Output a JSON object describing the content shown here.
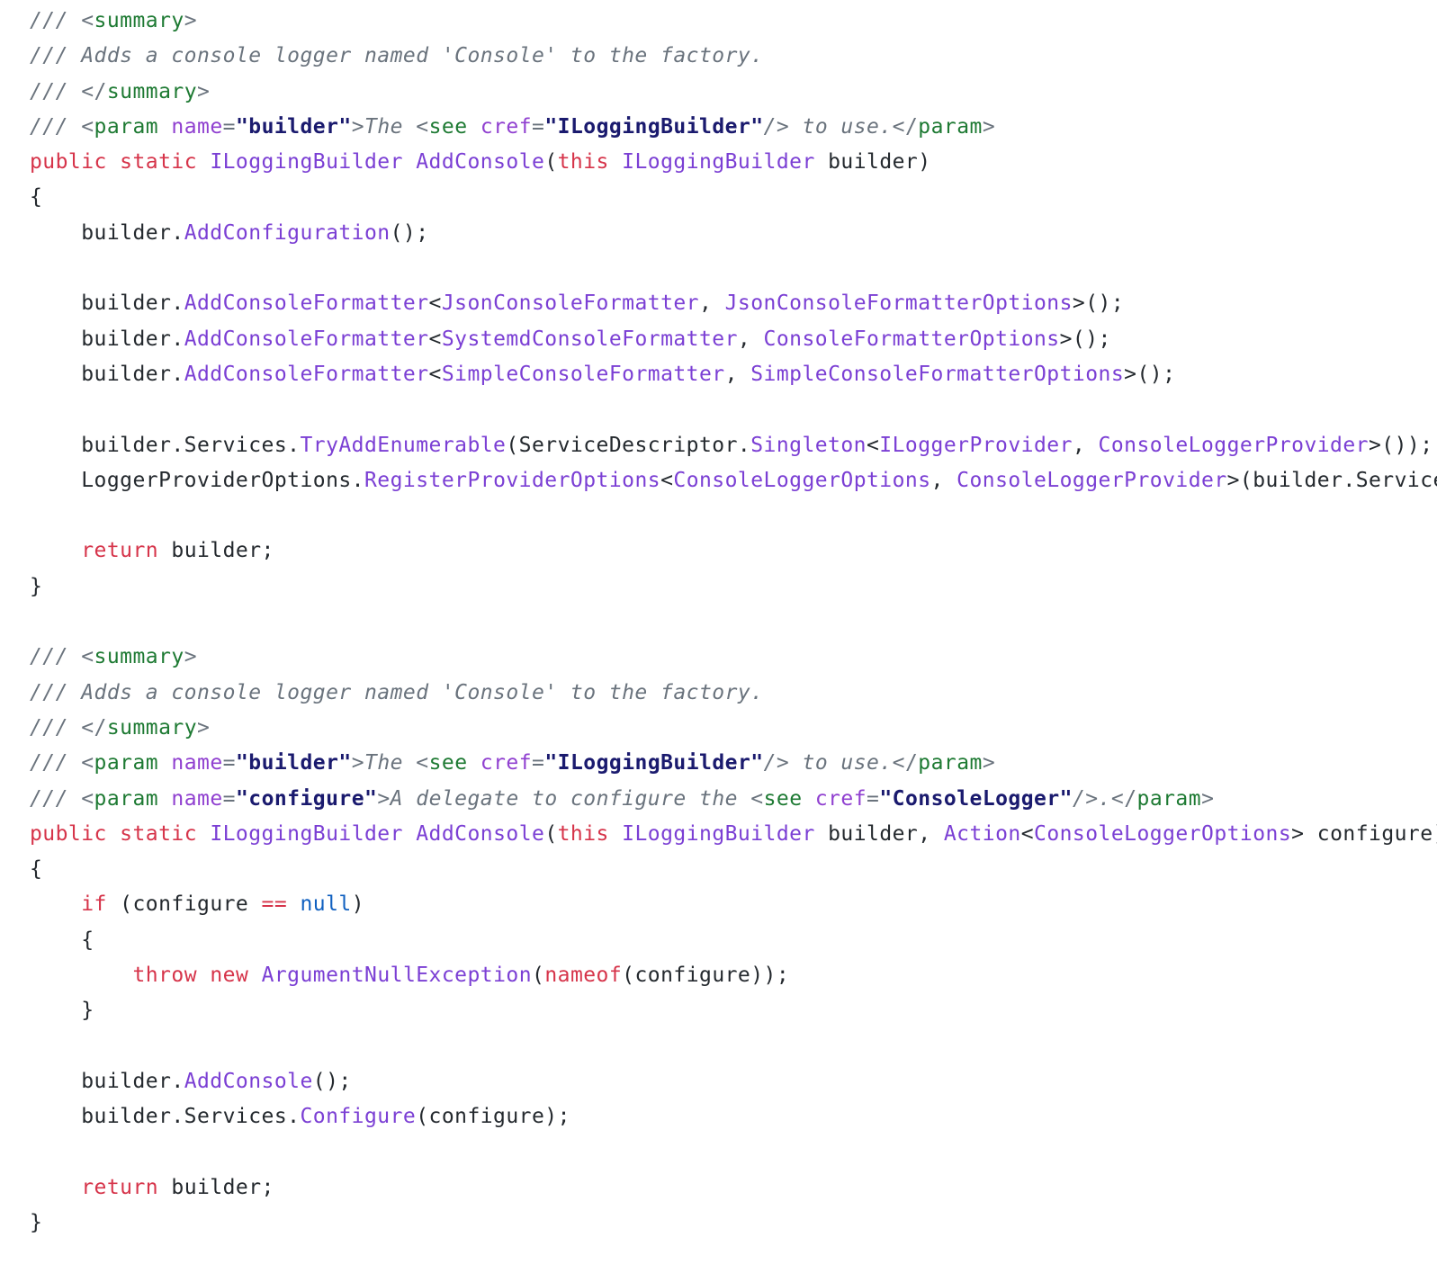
{
  "editor": {
    "language": "csharp",
    "background_color": "#ffffff",
    "font_size_px": 23,
    "line_height_px": 39.3,
    "indent_spaces": 4
  },
  "palette": {
    "plain": "#24292e",
    "comment": "#6a737d",
    "xml_tag": "#1e7a33",
    "xml_punctuation": "#6a737d",
    "xml_attribute_name": "#9040d0",
    "xml_attribute_value": "#1a1a6e",
    "keyword": "#d6344a",
    "null_literal": "#1060c0",
    "type": "#7b3fd4",
    "method": "#7b3fd4",
    "operator": "#d6344a"
  },
  "code": {
    "plain_text": "/// <summary>\n/// Adds a console logger named 'Console' to the factory.\n/// </summary>\n/// <param name=\"builder\">The <see cref=\"ILoggingBuilder\"/> to use.</param>\npublic static ILoggingBuilder AddConsole(this ILoggingBuilder builder)\n{\n    builder.AddConfiguration();\n\n    builder.AddConsoleFormatter<JsonConsoleFormatter, JsonConsoleFormatterOptions>();\n    builder.AddConsoleFormatter<SystemdConsoleFormatter, ConsoleFormatterOptions>();\n    builder.AddConsoleFormatter<SimpleConsoleFormatter, SimpleConsoleFormatterOptions>();\n\n    builder.Services.TryAddEnumerable(ServiceDescriptor.Singleton<ILoggerProvider, ConsoleLoggerProvider>());\n    LoggerProviderOptions.RegisterProviderOptions<ConsoleLoggerOptions, ConsoleLoggerProvider>(builder.Services);\n\n    return builder;\n}\n\n/// <summary>\n/// Adds a console logger named 'Console' to the factory.\n/// </summary>\n/// <param name=\"builder\">The <see cref=\"ILoggingBuilder\"/> to use.</param>\n/// <param name=\"configure\">A delegate to configure the <see cref=\"ConsoleLogger\"/>.</param>\npublic static ILoggingBuilder AddConsole(this ILoggingBuilder builder, Action<ConsoleLoggerOptions> configure)\n{\n    if (configure == null)\n    {\n        throw new ArgumentNullException(nameof(configure));\n    }\n\n    builder.AddConsole();\n    builder.Services.Configure(configure);\n\n    return builder;\n}",
    "lines": [
      {
        "tokens": [
          {
            "t": "/// ",
            "c": "comment"
          },
          {
            "t": "<",
            "c": "xml_punctuation"
          },
          {
            "t": "summary",
            "c": "xml_tag"
          },
          {
            "t": ">",
            "c": "xml_punctuation"
          }
        ]
      },
      {
        "tokens": [
          {
            "t": "/// Adds a console logger named 'Console' to the factory.",
            "c": "comment"
          }
        ]
      },
      {
        "tokens": [
          {
            "t": "/// ",
            "c": "comment"
          },
          {
            "t": "</",
            "c": "xml_punctuation"
          },
          {
            "t": "summary",
            "c": "xml_tag"
          },
          {
            "t": ">",
            "c": "xml_punctuation"
          }
        ]
      },
      {
        "tokens": [
          {
            "t": "/// ",
            "c": "comment"
          },
          {
            "t": "<",
            "c": "xml_punctuation"
          },
          {
            "t": "param",
            "c": "xml_tag"
          },
          {
            "t": " ",
            "c": "comment"
          },
          {
            "t": "name",
            "c": "xml_attribute_name"
          },
          {
            "t": "=",
            "c": "xml_punctuation"
          },
          {
            "t": "\"builder\"",
            "c": "xml_attribute_value"
          },
          {
            "t": ">The ",
            "c": "comment"
          },
          {
            "t": "<",
            "c": "xml_punctuation"
          },
          {
            "t": "see",
            "c": "xml_tag"
          },
          {
            "t": " ",
            "c": "comment"
          },
          {
            "t": "cref",
            "c": "xml_attribute_name"
          },
          {
            "t": "=",
            "c": "xml_punctuation"
          },
          {
            "t": "\"ILoggingBuilder\"",
            "c": "xml_attribute_value"
          },
          {
            "t": "/> to use.",
            "c": "comment"
          },
          {
            "t": "</",
            "c": "xml_punctuation"
          },
          {
            "t": "param",
            "c": "xml_tag"
          },
          {
            "t": ">",
            "c": "xml_punctuation"
          }
        ]
      },
      {
        "tokens": [
          {
            "t": "public",
            "c": "keyword"
          },
          {
            "t": " ",
            "c": "plain"
          },
          {
            "t": "static",
            "c": "keyword"
          },
          {
            "t": " ",
            "c": "plain"
          },
          {
            "t": "ILoggingBuilder",
            "c": "type"
          },
          {
            "t": " ",
            "c": "plain"
          },
          {
            "t": "AddConsole",
            "c": "method"
          },
          {
            "t": "(",
            "c": "plain"
          },
          {
            "t": "this",
            "c": "keyword"
          },
          {
            "t": " ",
            "c": "plain"
          },
          {
            "t": "ILoggingBuilder",
            "c": "type"
          },
          {
            "t": " builder)",
            "c": "plain"
          }
        ]
      },
      {
        "tokens": [
          {
            "t": "{",
            "c": "plain"
          }
        ]
      },
      {
        "tokens": [
          {
            "t": "    builder.",
            "c": "plain"
          },
          {
            "t": "AddConfiguration",
            "c": "method"
          },
          {
            "t": "();",
            "c": "plain"
          }
        ]
      },
      {
        "tokens": []
      },
      {
        "tokens": [
          {
            "t": "    builder.",
            "c": "plain"
          },
          {
            "t": "AddConsoleFormatter",
            "c": "method"
          },
          {
            "t": "<",
            "c": "plain"
          },
          {
            "t": "JsonConsoleFormatter",
            "c": "type"
          },
          {
            "t": ", ",
            "c": "plain"
          },
          {
            "t": "JsonConsoleFormatterOptions",
            "c": "type"
          },
          {
            "t": ">();",
            "c": "plain"
          }
        ]
      },
      {
        "tokens": [
          {
            "t": "    builder.",
            "c": "plain"
          },
          {
            "t": "AddConsoleFormatter",
            "c": "method"
          },
          {
            "t": "<",
            "c": "plain"
          },
          {
            "t": "SystemdConsoleFormatter",
            "c": "type"
          },
          {
            "t": ", ",
            "c": "plain"
          },
          {
            "t": "ConsoleFormatterOptions",
            "c": "type"
          },
          {
            "t": ">();",
            "c": "plain"
          }
        ]
      },
      {
        "tokens": [
          {
            "t": "    builder.",
            "c": "plain"
          },
          {
            "t": "AddConsoleFormatter",
            "c": "method"
          },
          {
            "t": "<",
            "c": "plain"
          },
          {
            "t": "SimpleConsoleFormatter",
            "c": "type"
          },
          {
            "t": ", ",
            "c": "plain"
          },
          {
            "t": "SimpleConsoleFormatterOptions",
            "c": "type"
          },
          {
            "t": ">();",
            "c": "plain"
          }
        ]
      },
      {
        "tokens": []
      },
      {
        "tokens": [
          {
            "t": "    builder.Services.",
            "c": "plain"
          },
          {
            "t": "TryAddEnumerable",
            "c": "method"
          },
          {
            "t": "(ServiceDescriptor.",
            "c": "plain"
          },
          {
            "t": "Singleton",
            "c": "method"
          },
          {
            "t": "<",
            "c": "plain"
          },
          {
            "t": "ILoggerProvider",
            "c": "type"
          },
          {
            "t": ", ",
            "c": "plain"
          },
          {
            "t": "ConsoleLoggerProvider",
            "c": "type"
          },
          {
            "t": ">());",
            "c": "plain"
          }
        ]
      },
      {
        "tokens": [
          {
            "t": "    LoggerProviderOptions.",
            "c": "plain"
          },
          {
            "t": "RegisterProviderOptions",
            "c": "method"
          },
          {
            "t": "<",
            "c": "plain"
          },
          {
            "t": "ConsoleLoggerOptions",
            "c": "type"
          },
          {
            "t": ", ",
            "c": "plain"
          },
          {
            "t": "ConsoleLoggerProvider",
            "c": "type"
          },
          {
            "t": ">(builder.Services);",
            "c": "plain"
          }
        ]
      },
      {
        "tokens": []
      },
      {
        "tokens": [
          {
            "t": "    ",
            "c": "plain"
          },
          {
            "t": "return",
            "c": "keyword"
          },
          {
            "t": " builder;",
            "c": "plain"
          }
        ]
      },
      {
        "tokens": [
          {
            "t": "}",
            "c": "plain"
          }
        ]
      },
      {
        "tokens": []
      },
      {
        "tokens": [
          {
            "t": "/// ",
            "c": "comment"
          },
          {
            "t": "<",
            "c": "xml_punctuation"
          },
          {
            "t": "summary",
            "c": "xml_tag"
          },
          {
            "t": ">",
            "c": "xml_punctuation"
          }
        ]
      },
      {
        "tokens": [
          {
            "t": "/// Adds a console logger named 'Console' to the factory.",
            "c": "comment"
          }
        ]
      },
      {
        "tokens": [
          {
            "t": "/// ",
            "c": "comment"
          },
          {
            "t": "</",
            "c": "xml_punctuation"
          },
          {
            "t": "summary",
            "c": "xml_tag"
          },
          {
            "t": ">",
            "c": "xml_punctuation"
          }
        ]
      },
      {
        "tokens": [
          {
            "t": "/// ",
            "c": "comment"
          },
          {
            "t": "<",
            "c": "xml_punctuation"
          },
          {
            "t": "param",
            "c": "xml_tag"
          },
          {
            "t": " ",
            "c": "comment"
          },
          {
            "t": "name",
            "c": "xml_attribute_name"
          },
          {
            "t": "=",
            "c": "xml_punctuation"
          },
          {
            "t": "\"builder\"",
            "c": "xml_attribute_value"
          },
          {
            "t": ">The ",
            "c": "comment"
          },
          {
            "t": "<",
            "c": "xml_punctuation"
          },
          {
            "t": "see",
            "c": "xml_tag"
          },
          {
            "t": " ",
            "c": "comment"
          },
          {
            "t": "cref",
            "c": "xml_attribute_name"
          },
          {
            "t": "=",
            "c": "xml_punctuation"
          },
          {
            "t": "\"ILoggingBuilder\"",
            "c": "xml_attribute_value"
          },
          {
            "t": "/> to use.",
            "c": "comment"
          },
          {
            "t": "</",
            "c": "xml_punctuation"
          },
          {
            "t": "param",
            "c": "xml_tag"
          },
          {
            "t": ">",
            "c": "xml_punctuation"
          }
        ]
      },
      {
        "tokens": [
          {
            "t": "/// ",
            "c": "comment"
          },
          {
            "t": "<",
            "c": "xml_punctuation"
          },
          {
            "t": "param",
            "c": "xml_tag"
          },
          {
            "t": " ",
            "c": "comment"
          },
          {
            "t": "name",
            "c": "xml_attribute_name"
          },
          {
            "t": "=",
            "c": "xml_punctuation"
          },
          {
            "t": "\"configure\"",
            "c": "xml_attribute_value"
          },
          {
            "t": ">A delegate to configure the ",
            "c": "comment"
          },
          {
            "t": "<",
            "c": "xml_punctuation"
          },
          {
            "t": "see",
            "c": "xml_tag"
          },
          {
            "t": " ",
            "c": "comment"
          },
          {
            "t": "cref",
            "c": "xml_attribute_name"
          },
          {
            "t": "=",
            "c": "xml_punctuation"
          },
          {
            "t": "\"ConsoleLogger\"",
            "c": "xml_attribute_value"
          },
          {
            "t": "/>.",
            "c": "comment"
          },
          {
            "t": "</",
            "c": "xml_punctuation"
          },
          {
            "t": "param",
            "c": "xml_tag"
          },
          {
            "t": ">",
            "c": "xml_punctuation"
          }
        ]
      },
      {
        "tokens": [
          {
            "t": "public",
            "c": "keyword"
          },
          {
            "t": " ",
            "c": "plain"
          },
          {
            "t": "static",
            "c": "keyword"
          },
          {
            "t": " ",
            "c": "plain"
          },
          {
            "t": "ILoggingBuilder",
            "c": "type"
          },
          {
            "t": " ",
            "c": "plain"
          },
          {
            "t": "AddConsole",
            "c": "method"
          },
          {
            "t": "(",
            "c": "plain"
          },
          {
            "t": "this",
            "c": "keyword"
          },
          {
            "t": " ",
            "c": "plain"
          },
          {
            "t": "ILoggingBuilder",
            "c": "type"
          },
          {
            "t": " builder, ",
            "c": "plain"
          },
          {
            "t": "Action",
            "c": "type"
          },
          {
            "t": "<",
            "c": "plain"
          },
          {
            "t": "ConsoleLoggerOptions",
            "c": "type"
          },
          {
            "t": "> configure)",
            "c": "plain"
          }
        ]
      },
      {
        "tokens": [
          {
            "t": "{",
            "c": "plain"
          }
        ]
      },
      {
        "tokens": [
          {
            "t": "    ",
            "c": "plain"
          },
          {
            "t": "if",
            "c": "keyword"
          },
          {
            "t": " (configure ",
            "c": "plain"
          },
          {
            "t": "==",
            "c": "operator"
          },
          {
            "t": " ",
            "c": "plain"
          },
          {
            "t": "null",
            "c": "null_literal"
          },
          {
            "t": ")",
            "c": "plain"
          }
        ]
      },
      {
        "tokens": [
          {
            "t": "    {",
            "c": "plain"
          }
        ]
      },
      {
        "tokens": [
          {
            "t": "        ",
            "c": "plain"
          },
          {
            "t": "throw",
            "c": "keyword"
          },
          {
            "t": " ",
            "c": "plain"
          },
          {
            "t": "new",
            "c": "keyword"
          },
          {
            "t": " ",
            "c": "plain"
          },
          {
            "t": "ArgumentNullException",
            "c": "type"
          },
          {
            "t": "(",
            "c": "plain"
          },
          {
            "t": "nameof",
            "c": "keyword"
          },
          {
            "t": "(configure));",
            "c": "plain"
          }
        ]
      },
      {
        "tokens": [
          {
            "t": "    }",
            "c": "plain"
          }
        ]
      },
      {
        "tokens": []
      },
      {
        "tokens": [
          {
            "t": "    builder.",
            "c": "plain"
          },
          {
            "t": "AddConsole",
            "c": "method"
          },
          {
            "t": "();",
            "c": "plain"
          }
        ]
      },
      {
        "tokens": [
          {
            "t": "    builder.Services.",
            "c": "plain"
          },
          {
            "t": "Configure",
            "c": "method"
          },
          {
            "t": "(configure);",
            "c": "plain"
          }
        ]
      },
      {
        "tokens": []
      },
      {
        "tokens": [
          {
            "t": "    ",
            "c": "plain"
          },
          {
            "t": "return",
            "c": "keyword"
          },
          {
            "t": " builder;",
            "c": "plain"
          }
        ]
      },
      {
        "tokens": [
          {
            "t": "}",
            "c": "plain"
          }
        ]
      }
    ]
  }
}
